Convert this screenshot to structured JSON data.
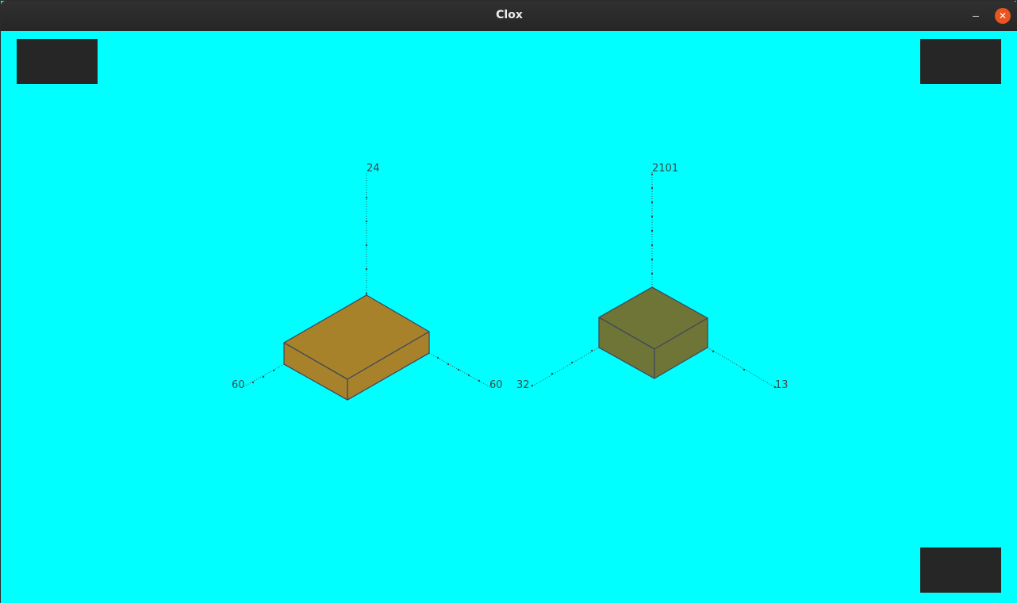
{
  "window": {
    "title": "Clox",
    "minimize_icon": "minimize-icon",
    "close_icon": "close-icon",
    "close_glyph": "✕",
    "close_color": "#e95420"
  },
  "background_color": "#00ffff",
  "corner_button_color": "#262626",
  "boxes": [
    {
      "name": "box-left",
      "color": "#a8822a",
      "labels": {
        "height": "24",
        "left": "60",
        "right": "60"
      }
    },
    {
      "name": "box-right",
      "color": "#6e7536",
      "labels": {
        "height": "2101",
        "left": "32",
        "right": "13"
      }
    }
  ]
}
